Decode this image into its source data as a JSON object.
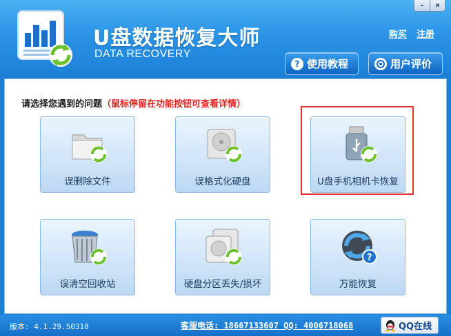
{
  "app": {
    "title": "U盘数据恢复大师",
    "subtitle": "DATA RECOVERY"
  },
  "window_controls": {
    "minimize": "-",
    "close": "×"
  },
  "top_links": {
    "buy": "购买",
    "register": "注册"
  },
  "header_buttons": {
    "tutorial": {
      "label": "使用教程",
      "icon": "?"
    },
    "review": {
      "label": "用户评价"
    }
  },
  "main": {
    "prompt": "请选择您遇到的问题",
    "hint": "（鼠标停留在功能按钮可查看详情）",
    "tiles": [
      {
        "label": "误删除文件",
        "icon": "folder-icon"
      },
      {
        "label": "误格式化硬盘",
        "icon": "hard-disk-icon"
      },
      {
        "label": "U盘手机相机卡恢复",
        "icon": "usb-drive-icon"
      },
      {
        "label": "误清空回收站",
        "icon": "recycle-bin-icon"
      },
      {
        "label": "硬盘分区丢失/损坏",
        "icon": "disk-partition-icon"
      },
      {
        "label": "万能恢复",
        "icon": "universal-recovery-icon"
      }
    ]
  },
  "footer": {
    "version": "版本: 4.1.29.50318",
    "contact": "客服电话: 18667133607 QQ: 4006718068",
    "qq_online": "QQ在线"
  },
  "colors": {
    "header_blue": "#2a93e6",
    "highlight_red": "#e23232",
    "hint_red": "#e52222",
    "recovery_green": "#6cbf2f"
  }
}
